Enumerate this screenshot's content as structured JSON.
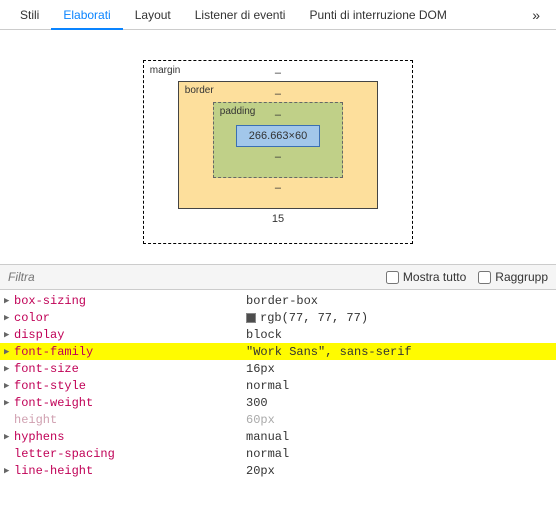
{
  "tabs": {
    "items": [
      "Stili",
      "Elaborati",
      "Layout",
      "Listener di eventi",
      "Punti di interruzione DOM"
    ],
    "active": 1,
    "more": "»"
  },
  "box_model": {
    "margin": {
      "label": "margin",
      "top": "–",
      "bottom": "15"
    },
    "border": {
      "label": "border",
      "top": "–",
      "bottom": "–"
    },
    "padding": {
      "label": "padding",
      "top": "–",
      "bottom": "–"
    },
    "content": "266.663×60"
  },
  "filter": {
    "placeholder": "Filtra",
    "show_all": "Mostra tutto",
    "group": "Raggrupp"
  },
  "props": [
    {
      "name": "box-sizing",
      "value": "border-box",
      "expandable": true
    },
    {
      "name": "color",
      "value": "rgb(77, 77, 77)",
      "swatch": true,
      "expandable": true
    },
    {
      "name": "display",
      "value": "block",
      "expandable": true
    },
    {
      "name": "font-family",
      "value": "\"Work Sans\", sans-serif",
      "expandable": true,
      "highlight": true
    },
    {
      "name": "font-size",
      "value": "16px",
      "expandable": true
    },
    {
      "name": "font-style",
      "value": "normal",
      "expandable": true
    },
    {
      "name": "font-weight",
      "value": "300",
      "expandable": true
    },
    {
      "name": "height",
      "value": "60px",
      "dim": true,
      "expandable": false
    },
    {
      "name": "hyphens",
      "value": "manual",
      "expandable": true
    },
    {
      "name": "letter-spacing",
      "value": "normal",
      "expandable": false
    },
    {
      "name": "line-height",
      "value": "20px",
      "expandable": true
    }
  ]
}
